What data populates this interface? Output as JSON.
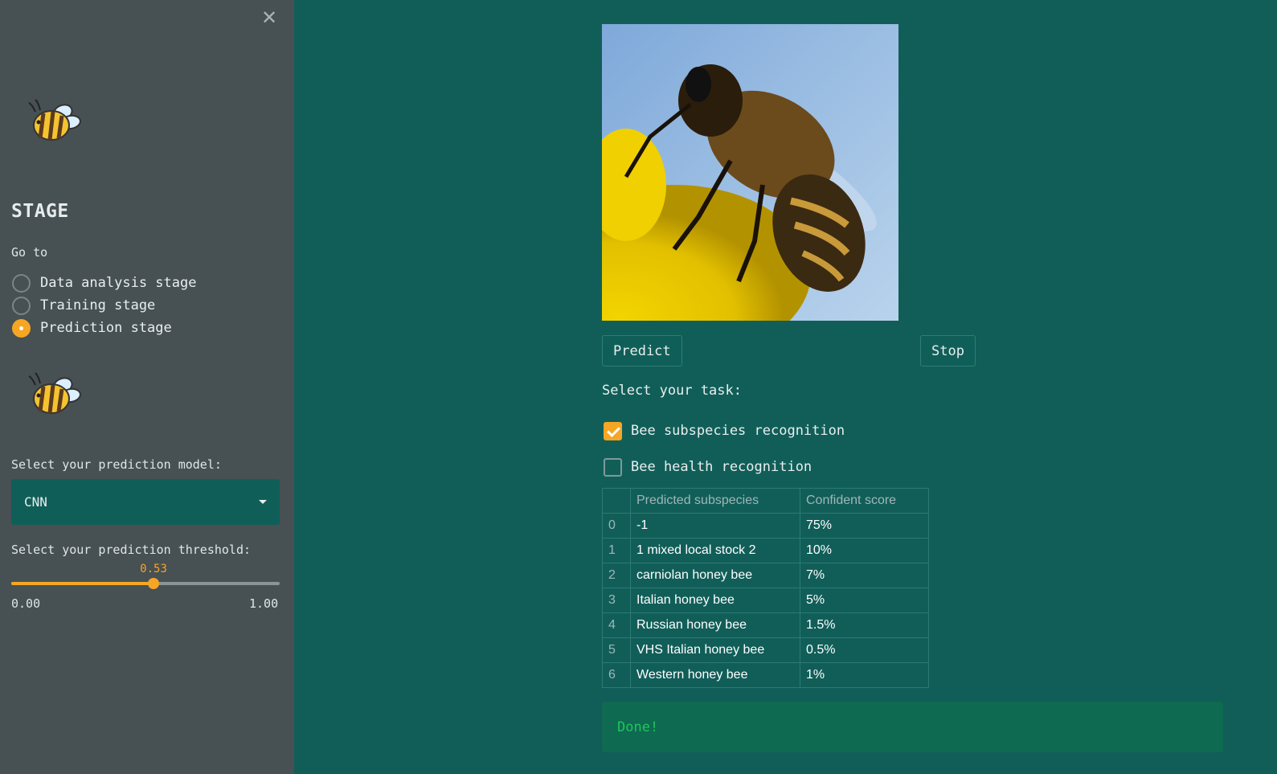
{
  "sidebar": {
    "close_icon": "close-icon",
    "logo_icon": "bee-icon",
    "title": "STAGE",
    "goto_label": "Go to",
    "stages": [
      {
        "label": "Data analysis stage",
        "selected": false
      },
      {
        "label": "Training stage",
        "selected": false
      },
      {
        "label": "Prediction stage",
        "selected": true
      }
    ],
    "model_label": "Select your prediction model:",
    "model_value": "CNN",
    "threshold_label": "Select your prediction threshold:",
    "threshold_value": "0.53",
    "threshold_fraction": 0.53,
    "threshold_min": "0.00",
    "threshold_max": "1.00"
  },
  "main": {
    "image_subject": "honey bee on yellow flower",
    "predict_label": "Predict",
    "stop_label": "Stop",
    "task_label": "Select your task:",
    "tasks": [
      {
        "label": "Bee subspecies recognition",
        "checked": true
      },
      {
        "label": "Bee health recognition",
        "checked": false
      }
    ],
    "table": {
      "headers": [
        "",
        "Predicted subspecies",
        "Confident score"
      ],
      "rows": [
        [
          "0",
          "-1",
          "75%"
        ],
        [
          "1",
          "1 mixed local stock 2",
          "10%"
        ],
        [
          "2",
          "carniolan honey bee",
          "7%"
        ],
        [
          "3",
          "Italian honey bee",
          "5%"
        ],
        [
          "4",
          "Russian honey bee",
          "1.5%"
        ],
        [
          "5",
          "VHS Italian honey bee",
          "0.5%"
        ],
        [
          "6",
          "Western honey bee",
          "1%"
        ]
      ]
    },
    "status_text": "Done!"
  },
  "colors": {
    "main_bg": "#115e59",
    "sidebar_bg": "#475053",
    "accent": "#f6a623",
    "success_bg": "#0e6a50",
    "success_text": "#21c45d"
  }
}
